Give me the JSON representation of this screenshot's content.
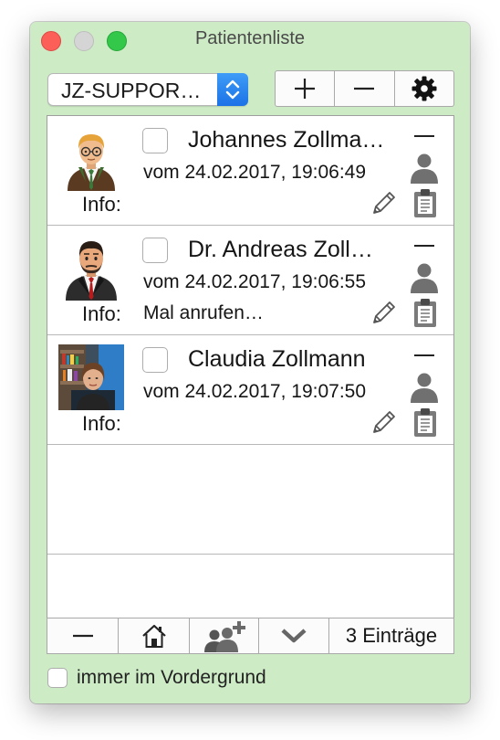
{
  "window": {
    "title": "Patientenliste"
  },
  "toolbar": {
    "practice_select": "JZ-SUPPOR…",
    "add_icon": "plus-icon",
    "remove_icon": "minus-icon",
    "settings_icon": "gear-icon"
  },
  "patients": [
    {
      "name": "Johannes Zollma…",
      "date": "vom 24.02.2017, 19:06:49",
      "info_label": "Info:",
      "info": "",
      "avatar": "cartoon-man-glasses-avatar"
    },
    {
      "name": "Dr. Andreas Zoll…",
      "date": "vom 24.02.2017, 19:06:55",
      "info_label": "Info:",
      "info": "Mal anrufen…",
      "avatar": "cartoon-man-suit-avatar"
    },
    {
      "name": "Claudia Zollmann",
      "date": "vom 24.02.2017, 19:07:50",
      "info_label": "Info:",
      "info": "",
      "avatar": "woman-photo-avatar"
    }
  ],
  "bottom": {
    "remove_icon": "minus-icon",
    "home_icon": "house-icon",
    "add_group_icon": "group-add-icon",
    "expand_icon": "chevron-down-icon",
    "count_label": "3 Einträge"
  },
  "footer": {
    "always_on_top_label": "immer im Vordergrund",
    "always_on_top_checked": false
  },
  "colors": {
    "window_bg": "#cdebc5",
    "accent_blue": "#1b72e6",
    "icon_gray": "#707070"
  }
}
